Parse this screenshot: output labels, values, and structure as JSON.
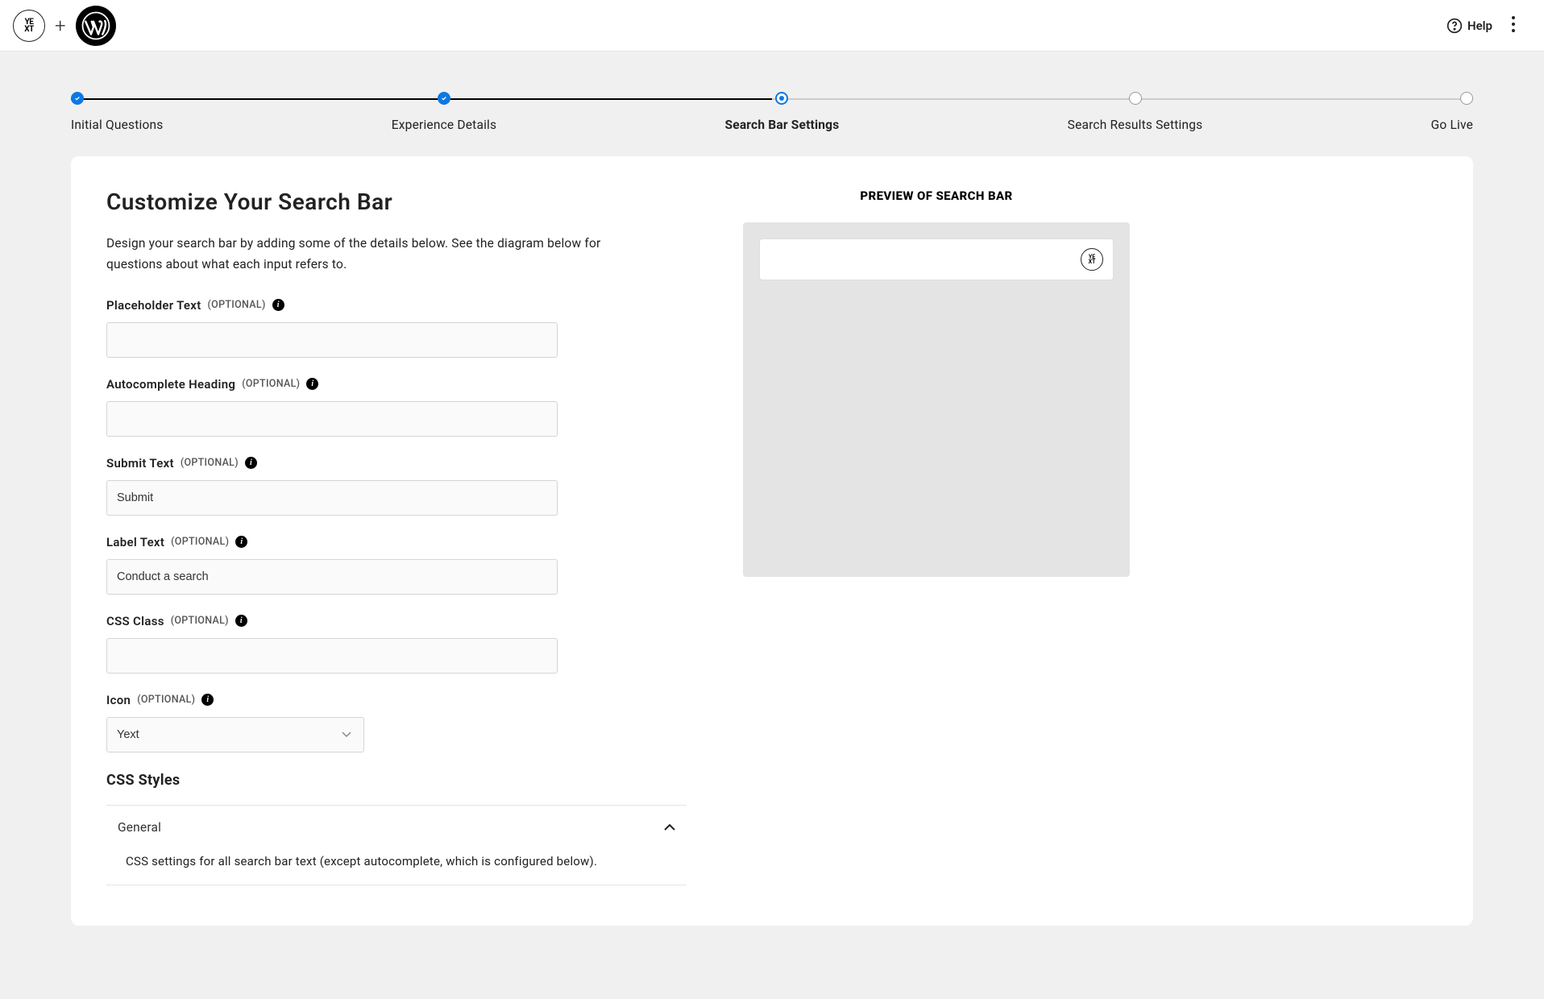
{
  "header": {
    "help_label": "Help"
  },
  "stepper": {
    "steps": [
      {
        "label": "Initial Questions",
        "state": "completed"
      },
      {
        "label": "Experience Details",
        "state": "completed"
      },
      {
        "label": "Search Bar Settings",
        "state": "current"
      },
      {
        "label": "Search Results Settings",
        "state": "upcoming"
      },
      {
        "label": "Go Live",
        "state": "upcoming"
      }
    ],
    "progress_percent": 50
  },
  "page": {
    "title": "Customize Your Search Bar",
    "description": "Design your search bar by adding some of the details below. See the diagram below for questions about what each input refers to."
  },
  "fields": {
    "placeholder_text": {
      "label": "Placeholder Text",
      "optional": "(Optional)",
      "value": ""
    },
    "autocomplete_heading": {
      "label": "Autocomplete Heading",
      "optional": "(Optional)",
      "value": ""
    },
    "submit_text": {
      "label": "Submit Text",
      "optional": "(Optional)",
      "value": "Submit"
    },
    "label_text": {
      "label": "Label Text",
      "optional": "(Optional)",
      "value": "Conduct a search"
    },
    "css_class": {
      "label": "CSS Class",
      "optional": "(Optional)",
      "value": ""
    },
    "icon": {
      "label": "Icon",
      "optional": "(Optional)",
      "value": "Yext"
    }
  },
  "css_styles": {
    "heading": "CSS Styles",
    "accordion": {
      "title": "General",
      "body": "CSS settings for all search bar text (except autocomplete, which is configured below)."
    }
  },
  "preview": {
    "heading": "Preview of Search Bar"
  }
}
